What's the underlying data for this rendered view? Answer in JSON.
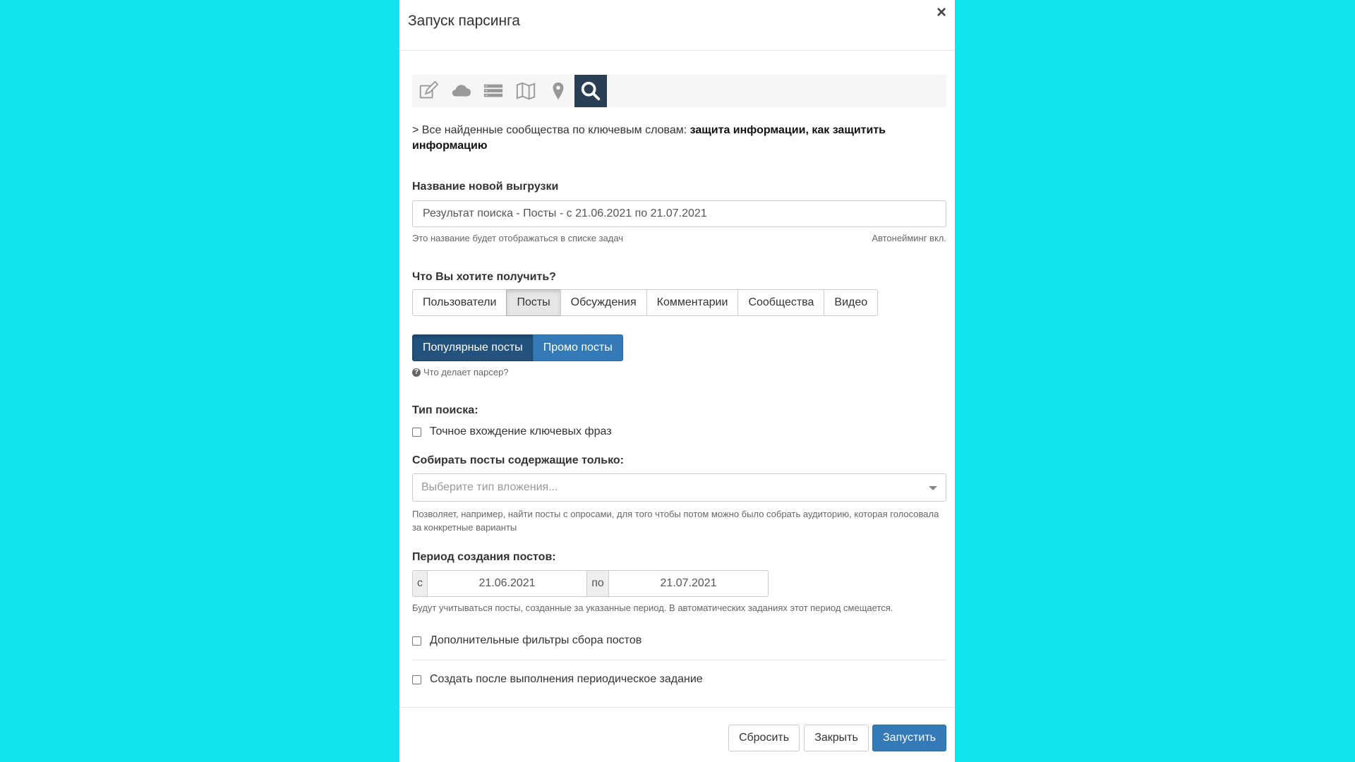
{
  "modal": {
    "title": "Запуск парсинга",
    "close": "×"
  },
  "toolbar": {
    "icons": [
      "edit-icon",
      "cloud-icon",
      "list-icon",
      "map-icon",
      "map-pin-icon",
      "search-icon"
    ],
    "active": "search-icon"
  },
  "description": {
    "prefix": "> Все найденные сообщества по ключевым словам: ",
    "keywords": "защита информации, как защитить информацию"
  },
  "export_name": {
    "label": "Название новой выгрузки",
    "value": "Результат поиска - Посты  - с 21.06.2021 по 21.07.2021",
    "help": "Это название будет отображаться в списке задач",
    "autonaming": "Автонейминг вкл."
  },
  "target": {
    "label": "Что Вы хотите получить?",
    "options": [
      "Пользователи",
      "Посты",
      "Обсуждения",
      "Комментарии",
      "Сообщества",
      "Видео"
    ],
    "selected": "Посты"
  },
  "post_type": {
    "options": [
      "Популярные посты",
      "Промо посты"
    ],
    "selected": "Популярные посты",
    "help_link": "Что делает парсер?"
  },
  "search_type": {
    "label": "Тип поиска:",
    "exact_match_label": "Точное вхождение ключевых фраз",
    "exact_match_checked": false
  },
  "attachments": {
    "label": "Собирать посты содержащие только:",
    "placeholder": "Выберите тип вложения...",
    "help": "Позволяет, например, найти посты с опросами, для того чтобы потом можно было собрать аудиторию, которая голосовала за конкретные варианты"
  },
  "period": {
    "label": "Период создания постов:",
    "from_prefix": "с",
    "from": "21.06.2021",
    "to_prefix": "по",
    "to": "21.07.2021",
    "help": "Будут учитываться посты, созданные за указанные период. В автоматических заданиях этот период смещается."
  },
  "extra_filters": {
    "label": "Дополнительные фильтры сбора постов",
    "checked": false
  },
  "periodic_task": {
    "label": "Создать после выполнения периодическое задание",
    "checked": false
  },
  "footer": {
    "reset": "Сбросить",
    "close": "Закрыть",
    "run": "Запустить"
  },
  "colors": {
    "background": "#0fe4ef",
    "primary": "#337ab7",
    "primary_active": "#23527c",
    "toolbar_active": "#2a3f54"
  }
}
